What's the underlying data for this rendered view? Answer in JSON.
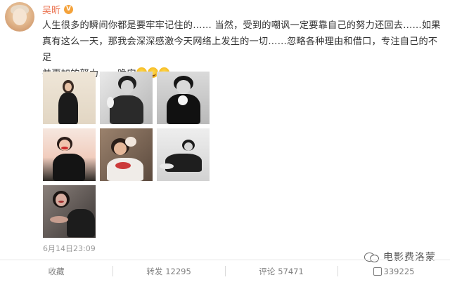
{
  "post": {
    "author_name": "吴昕",
    "verified_badge": "V",
    "text_line1": "人生很多的瞬间你都是要牢牢记住的…… 当然，受到的嘲讽一定要靠自己的努力还回去……如果",
    "text_line2": "真有这么一天，那我会深深感激今天网络上发生的一切……忽略各种理由和借口，专注自己的不足",
    "text_line3": "并更加的努力……晚安",
    "emojis": [
      "laugh-cry-emoji",
      "laugh-cry-emoji",
      "laugh-cry-emoji"
    ],
    "timestamp": "6月14日23:09"
  },
  "photos": [
    {
      "label": "photo-1",
      "bg": "#e9e1d5"
    },
    {
      "label": "photo-2",
      "bg": "#cfcfcf"
    },
    {
      "label": "photo-3",
      "bg": "#d9d9d9"
    },
    {
      "label": "photo-4",
      "bg": "#f3d2c8"
    },
    {
      "label": "photo-5",
      "bg": "#7d6a5a"
    },
    {
      "label": "photo-6",
      "bg": "#e6e6e6"
    },
    {
      "label": "photo-7",
      "bg": "#6d6663"
    }
  ],
  "actions": {
    "favorite_label": "收藏",
    "repost_label": "转发",
    "repost_count": "12295",
    "comment_label": "评论",
    "comment_count": "57471",
    "like_count": "339225"
  },
  "watermark": {
    "text": "电影费洛蒙",
    "icon": "wechat-icon"
  },
  "colors": {
    "name": "#eb7350",
    "badge": "#f4a23a",
    "meta": "#999999"
  }
}
